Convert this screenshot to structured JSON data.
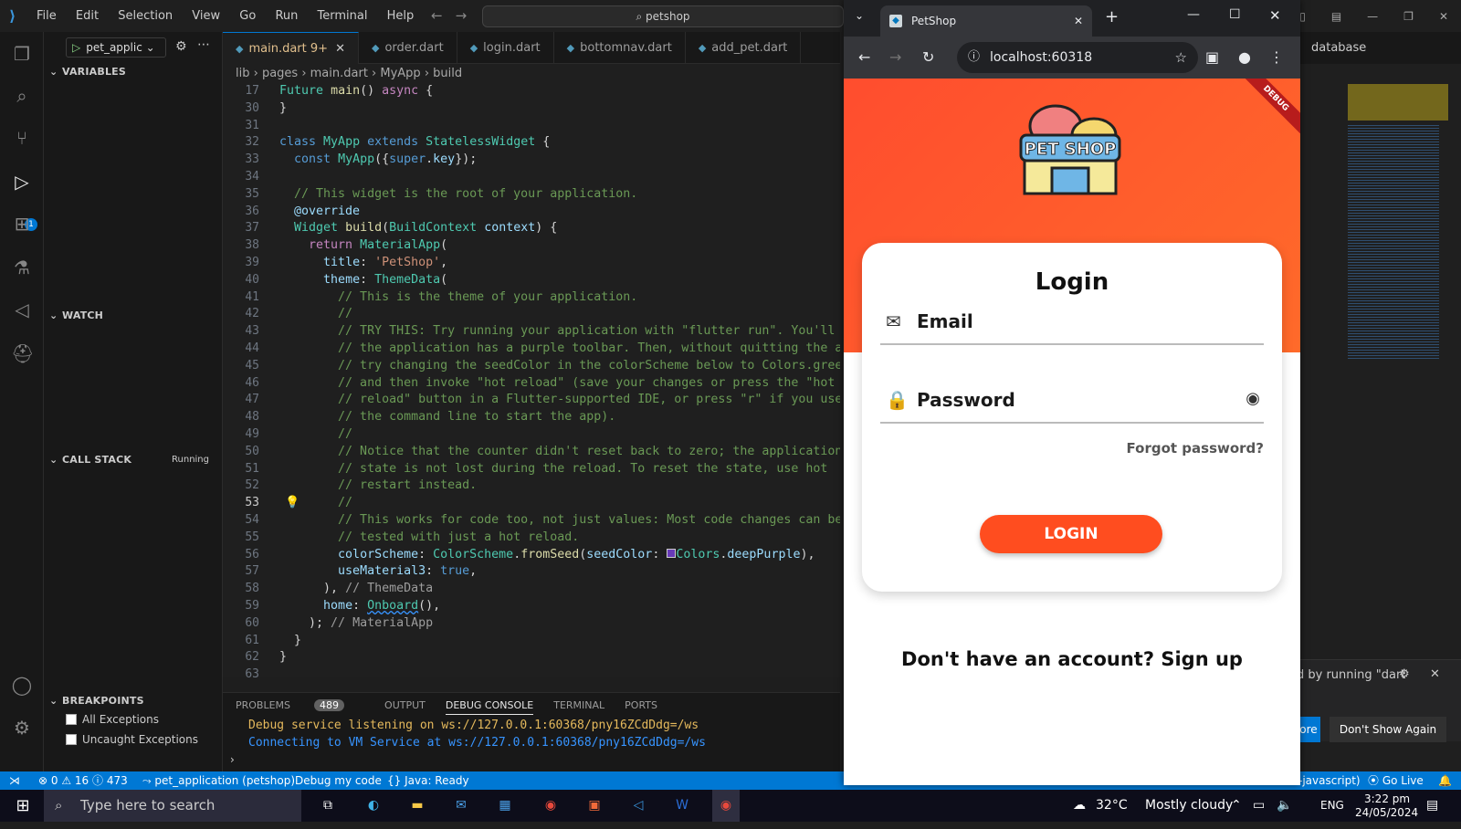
{
  "window": {
    "search_text": "petshop"
  },
  "menu": [
    "File",
    "Edit",
    "Selection",
    "View",
    "Go",
    "Run",
    "Terminal",
    "Help"
  ],
  "debug": {
    "config": "pet_applic"
  },
  "sidebar": {
    "variables": "VARIABLES",
    "watch": "WATCH",
    "call_stack": "CALL STACK",
    "call_stack_status": "Running",
    "breakpoints": "BREAKPOINTS",
    "bp_items": [
      "All Exceptions",
      "Uncaught Exceptions"
    ]
  },
  "tabs": [
    "main.dart",
    "order.dart",
    "login.dart",
    "bottomnav.dart",
    "add_pet.dart"
  ],
  "active_tab_badge": "9+",
  "breadcrumb": "lib › pages › main.dart › MyApp › build",
  "code": {
    "line_numbers": [
      "17",
      "30",
      "31",
      "32",
      "33",
      "34",
      "35",
      "36",
      "37",
      "38",
      "39",
      "40",
      "41",
      "42",
      "43",
      "44",
      "45",
      "46",
      "47",
      "48",
      "49",
      "50",
      "51",
      "52",
      "53",
      "54",
      "55",
      "56",
      "57",
      "58",
      "59",
      "60",
      "61",
      "62",
      "63"
    ]
  },
  "panel": {
    "tabs": [
      "PROBLEMS",
      "OUTPUT",
      "DEBUG CONSOLE",
      "TERMINAL",
      "PORTS"
    ],
    "problems_count": "489",
    "line1": "Debug service listening on ws://127.0.0.1:60368/pny16ZCdDdg=/ws",
    "line2": "Connecting to VM Service at ws://127.0.0.1:60368/pny16ZCdDdg=/ws"
  },
  "status": {
    "errors": "0",
    "warnings": "16",
    "info": "473",
    "target": "pet_application (petshop)",
    "debug_mode": "Debug my code",
    "java": "Java: Ready",
    "lang": "-javascript)",
    "golive": "Go Live"
  },
  "right_editor": {
    "tab_label": "database",
    "toast_text": "d by running \"dart",
    "toast_btn1": "ore",
    "toast_btn2": "Don't Show Again"
  },
  "browser": {
    "tab_title": "PetShop",
    "url": "localhost:60318"
  },
  "app": {
    "badge": "DEBUG",
    "logo_text": "PET SHOP",
    "title": "Login",
    "email_label": "Email",
    "password_label": "Password",
    "forgot": "Forgot password?",
    "login_button": "LOGIN",
    "signup": "Don't have an account? Sign up"
  },
  "taskbar": {
    "search_placeholder": "Type here to search",
    "temperature": "32°C",
    "weather": "Mostly cloudy",
    "lang": "ENG",
    "time": "3:22 pm",
    "date": "24/05/2024"
  }
}
